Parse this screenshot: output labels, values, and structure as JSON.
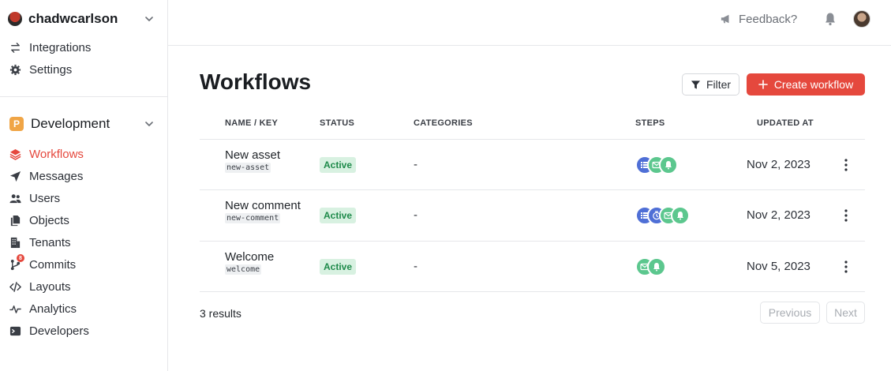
{
  "sidebar": {
    "account_name": "chadwcarlson",
    "top_items": [
      {
        "label": "Integrations",
        "icon": "arrows-exchange-icon"
      },
      {
        "label": "Settings",
        "icon": "gear-icon"
      }
    ],
    "environment": {
      "badge": "P",
      "name": "Development",
      "badge_color": "#f0a546"
    },
    "items": [
      {
        "label": "Workflows",
        "icon": "layers-icon",
        "active": true
      },
      {
        "label": "Messages",
        "icon": "paper-plane-icon"
      },
      {
        "label": "Users",
        "icon": "users-icon"
      },
      {
        "label": "Objects",
        "icon": "files-icon"
      },
      {
        "label": "Tenants",
        "icon": "building-icon"
      },
      {
        "label": "Commits",
        "icon": "git-branch-icon",
        "badge": "8"
      },
      {
        "label": "Layouts",
        "icon": "code-icon"
      },
      {
        "label": "Analytics",
        "icon": "pulse-icon"
      },
      {
        "label": "Developers",
        "icon": "terminal-icon"
      }
    ]
  },
  "topbar": {
    "feedback_label": "Feedback?"
  },
  "page": {
    "title": "Workflows"
  },
  "toolbar": {
    "filter_label": "Filter",
    "create_label": "Create workflow"
  },
  "table": {
    "columns": [
      "NAME / KEY",
      "STATUS",
      "CATEGORIES",
      "STEPS",
      "UPDATED AT"
    ],
    "rows": [
      {
        "name": "New asset",
        "key": "new-asset",
        "status": "Active",
        "categories": "-",
        "steps": [
          "list",
          "email",
          "push"
        ],
        "updated": "Nov 2, 2023"
      },
      {
        "name": "New comment",
        "key": "new-comment",
        "status": "Active",
        "categories": "-",
        "steps": [
          "list",
          "delay",
          "email",
          "push"
        ],
        "updated": "Nov 2, 2023"
      },
      {
        "name": "Welcome",
        "key": "welcome",
        "status": "Active",
        "categories": "-",
        "steps": [
          "email",
          "push"
        ],
        "updated": "Nov 5, 2023"
      }
    ]
  },
  "footer": {
    "results": "3 results",
    "previous_label": "Previous",
    "next_label": "Next"
  },
  "colors": {
    "accent": "#e5483d",
    "active_bg": "#d8f1e1",
    "active_fg": "#1e8a4a",
    "step_blue": "#4f6fd6",
    "step_green": "#5cc78e"
  }
}
